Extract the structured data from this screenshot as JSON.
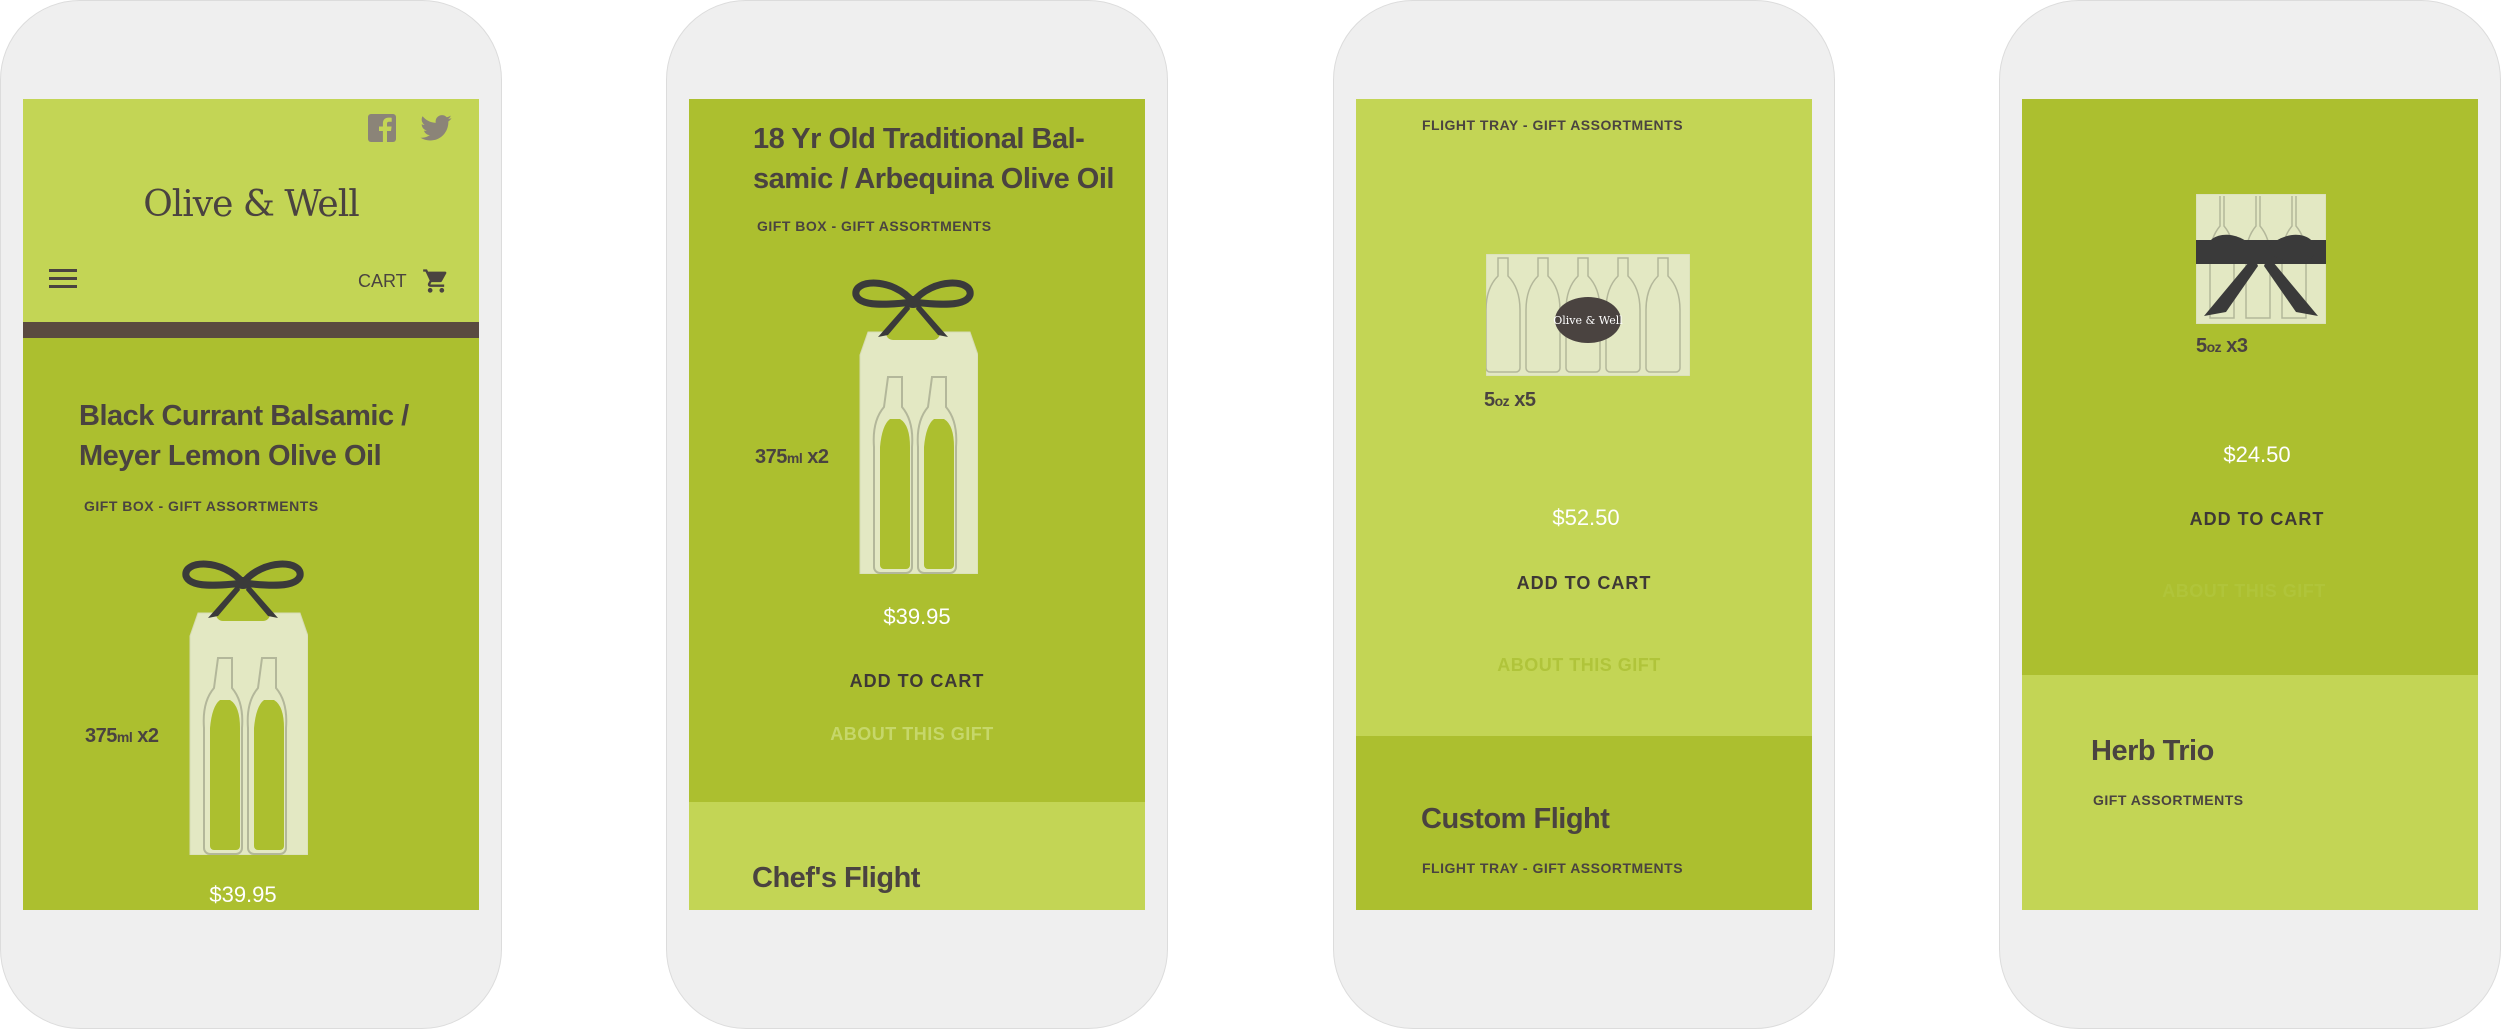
{
  "brand": {
    "logo": "Olive & Well",
    "badge_logo": "Olive & Well",
    "colors": {
      "lime": "#acbf2f",
      "lime_light": "#c3d555",
      "dark": "#4a4340",
      "divider": "#5a4a40"
    }
  },
  "header": {
    "social": [
      "facebook-icon",
      "twitter-icon"
    ],
    "menu_icon": "hamburger-icon",
    "cart_label": "CART",
    "cart_icon": "shopping-cart-icon"
  },
  "screens": [
    {
      "products": [
        {
          "title_lines": [
            "Black Currant Balsamic /",
            "Meyer Lemon Olive Oil"
          ],
          "category": "GIFT BOX - GIFT ASSORTMENTS",
          "size_num": "375",
          "size_unit": "ml",
          "size_qty": "x2",
          "price": "$39.95"
        }
      ]
    },
    {
      "products": [
        {
          "title_lines": [
            "18 Yr Old Traditional Bal-",
            "samic / Arbequina Olive Oil"
          ],
          "category": "GIFT BOX - GIFT ASSORTMENTS",
          "size_num": "375",
          "size_unit": "ml",
          "size_qty": "x2",
          "price": "$39.95",
          "add_to_cart": "ADD TO CART",
          "about": "ABOUT THIS GIFT"
        },
        {
          "title": "Chef's Flight"
        }
      ]
    },
    {
      "products": [
        {
          "category": "FLIGHT TRAY - GIFT ASSORTMENTS",
          "size_num": "5",
          "size_unit": "oz",
          "size_qty": "x5",
          "price": "$52.50",
          "add_to_cart": "ADD TO CART",
          "about": "ABOUT THIS GIFT"
        },
        {
          "title": "Custom Flight",
          "category": "FLIGHT TRAY - GIFT ASSORTMENTS"
        }
      ]
    },
    {
      "products": [
        {
          "size_num": "5",
          "size_unit": "oz",
          "size_qty": "x3",
          "price": "$24.50",
          "add_to_cart": "ADD TO CART",
          "about": "ABOUT THIS GIFT"
        },
        {
          "title": "Herb Trio",
          "category": "GIFT ASSORTMENTS"
        }
      ]
    }
  ]
}
